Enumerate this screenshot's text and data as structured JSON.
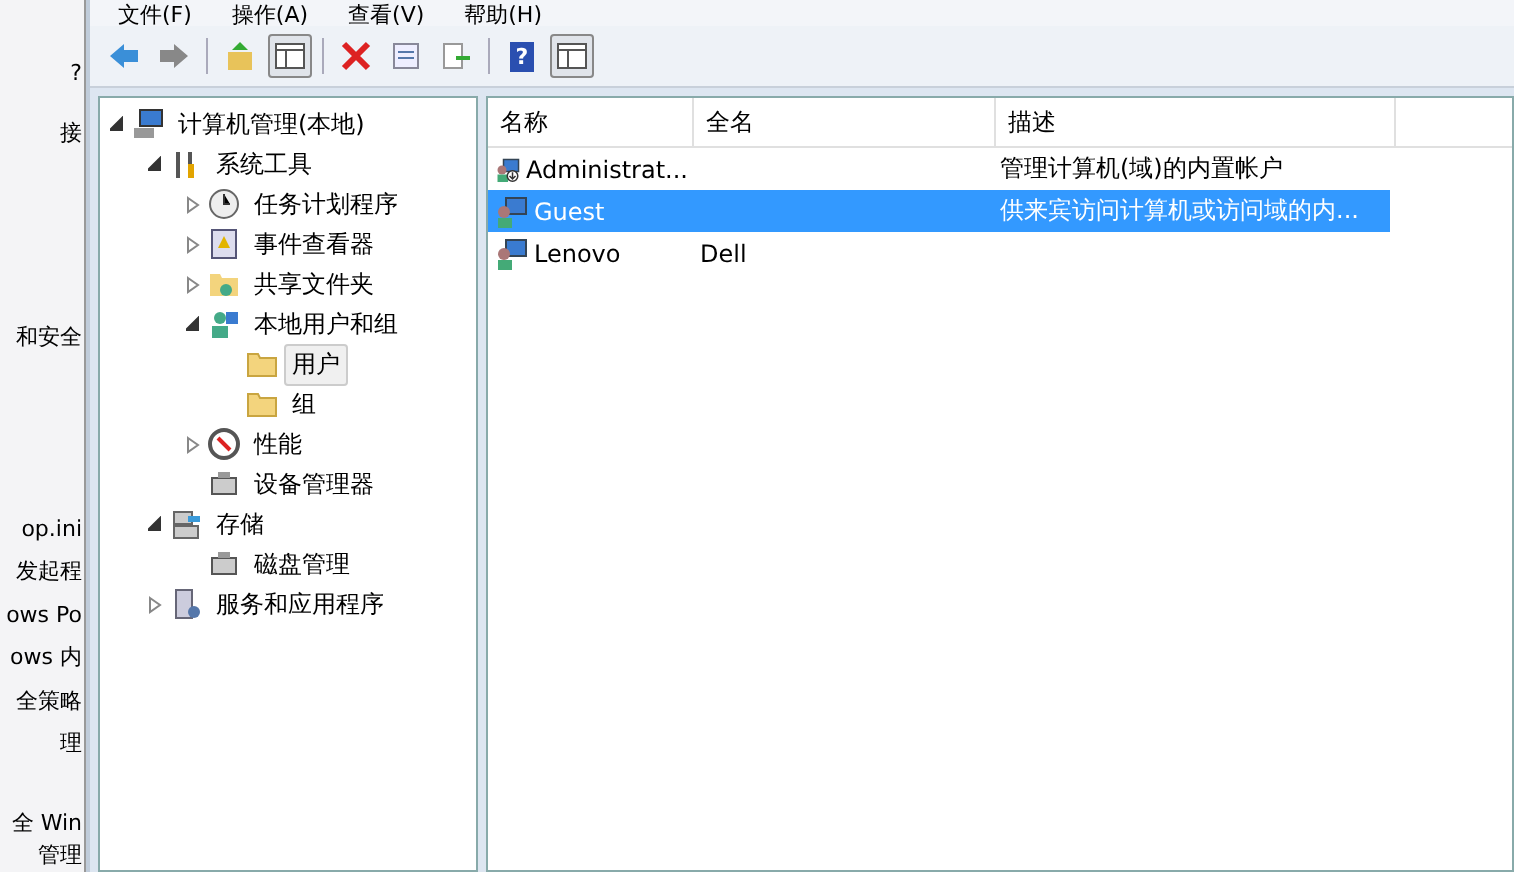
{
  "background_window": {
    "items": [
      "?",
      "接",
      "和安全",
      "op.ini",
      "发起程",
      "ows Po",
      "ows 内",
      "全策略",
      "理",
      "全 Win",
      "管理"
    ]
  },
  "menu": [
    "文件(F)",
    "操作(A)",
    "查看(V)",
    "帮助(H)"
  ],
  "toolbar": [
    {
      "kind": "back"
    },
    {
      "kind": "forward"
    },
    {
      "kind": "sep"
    },
    {
      "kind": "up"
    },
    {
      "kind": "pane",
      "selected": true
    },
    {
      "kind": "sep"
    },
    {
      "kind": "delete"
    },
    {
      "kind": "properties"
    },
    {
      "kind": "export"
    },
    {
      "kind": "sep"
    },
    {
      "kind": "help",
      "label": "?"
    },
    {
      "kind": "pane2",
      "selected": true
    }
  ],
  "tree": [
    {
      "label": "计算机管理(本地)",
      "kind": "computer",
      "expanded": true,
      "selected": false,
      "children": [
        {
          "label": "系统工具",
          "kind": "tools",
          "expanded": true,
          "selected": false,
          "children": [
            {
              "label": "任务计划程序",
              "kind": "clock",
              "expanded": false,
              "selected": false
            },
            {
              "label": "事件查看器",
              "kind": "log",
              "expanded": false,
              "selected": false
            },
            {
              "label": "共享文件夹",
              "kind": "share",
              "expanded": false,
              "selected": false
            },
            {
              "label": "本地用户和组",
              "kind": "users",
              "expanded": true,
              "selected": false,
              "children": [
                {
                  "label": "用户",
                  "kind": "folder",
                  "selected": true
                },
                {
                  "label": "组",
                  "kind": "folder",
                  "selected": false
                }
              ]
            },
            {
              "label": "性能",
              "kind": "gauge",
              "expanded": false,
              "selected": false
            },
            {
              "label": "设备管理器",
              "kind": "device",
              "selected": false
            }
          ]
        },
        {
          "label": "存储",
          "kind": "storage",
          "expanded": true,
          "selected": false,
          "children": [
            {
              "label": "磁盘管理",
              "kind": "device",
              "selected": false
            }
          ]
        },
        {
          "label": "服务和应用程序",
          "kind": "server",
          "expanded": false,
          "selected": false
        }
      ]
    }
  ],
  "table": {
    "columns": [
      "名称",
      "全名",
      "描述"
    ],
    "rows": [
      {
        "name": "Administrat...",
        "description": "管理计算机(域)的内置帐户",
        "selected": false,
        "admin": true
      },
      {
        "name": "Guest",
        "description": "供来宾访问计算机或访问域的内...",
        "selected": true,
        "admin": false
      },
      {
        "name": "Lenovo",
        "full_name": "Dell",
        "selected": false,
        "admin": false
      }
    ]
  }
}
